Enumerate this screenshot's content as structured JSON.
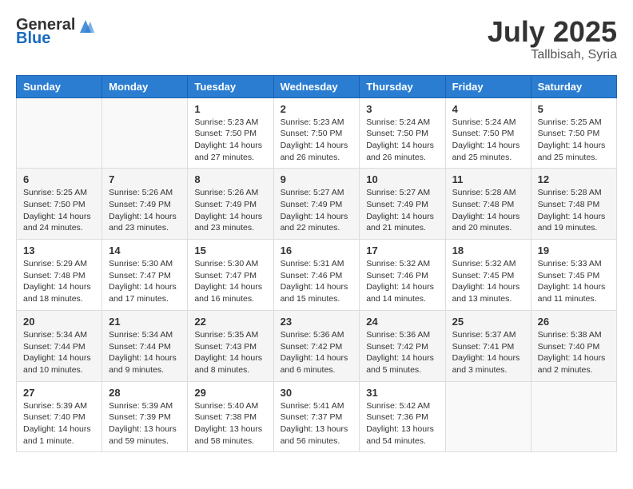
{
  "header": {
    "logo_general": "General",
    "logo_blue": "Blue",
    "month_year": "July 2025",
    "location": "Tallbisah, Syria"
  },
  "weekdays": [
    "Sunday",
    "Monday",
    "Tuesday",
    "Wednesday",
    "Thursday",
    "Friday",
    "Saturday"
  ],
  "weeks": [
    [
      {
        "day": "",
        "info": ""
      },
      {
        "day": "",
        "info": ""
      },
      {
        "day": "1",
        "info": "Sunrise: 5:23 AM\nSunset: 7:50 PM\nDaylight: 14 hours and 27 minutes."
      },
      {
        "day": "2",
        "info": "Sunrise: 5:23 AM\nSunset: 7:50 PM\nDaylight: 14 hours and 26 minutes."
      },
      {
        "day": "3",
        "info": "Sunrise: 5:24 AM\nSunset: 7:50 PM\nDaylight: 14 hours and 26 minutes."
      },
      {
        "day": "4",
        "info": "Sunrise: 5:24 AM\nSunset: 7:50 PM\nDaylight: 14 hours and 25 minutes."
      },
      {
        "day": "5",
        "info": "Sunrise: 5:25 AM\nSunset: 7:50 PM\nDaylight: 14 hours and 25 minutes."
      }
    ],
    [
      {
        "day": "6",
        "info": "Sunrise: 5:25 AM\nSunset: 7:50 PM\nDaylight: 14 hours and 24 minutes."
      },
      {
        "day": "7",
        "info": "Sunrise: 5:26 AM\nSunset: 7:49 PM\nDaylight: 14 hours and 23 minutes."
      },
      {
        "day": "8",
        "info": "Sunrise: 5:26 AM\nSunset: 7:49 PM\nDaylight: 14 hours and 23 minutes."
      },
      {
        "day": "9",
        "info": "Sunrise: 5:27 AM\nSunset: 7:49 PM\nDaylight: 14 hours and 22 minutes."
      },
      {
        "day": "10",
        "info": "Sunrise: 5:27 AM\nSunset: 7:49 PM\nDaylight: 14 hours and 21 minutes."
      },
      {
        "day": "11",
        "info": "Sunrise: 5:28 AM\nSunset: 7:48 PM\nDaylight: 14 hours and 20 minutes."
      },
      {
        "day": "12",
        "info": "Sunrise: 5:28 AM\nSunset: 7:48 PM\nDaylight: 14 hours and 19 minutes."
      }
    ],
    [
      {
        "day": "13",
        "info": "Sunrise: 5:29 AM\nSunset: 7:48 PM\nDaylight: 14 hours and 18 minutes."
      },
      {
        "day": "14",
        "info": "Sunrise: 5:30 AM\nSunset: 7:47 PM\nDaylight: 14 hours and 17 minutes."
      },
      {
        "day": "15",
        "info": "Sunrise: 5:30 AM\nSunset: 7:47 PM\nDaylight: 14 hours and 16 minutes."
      },
      {
        "day": "16",
        "info": "Sunrise: 5:31 AM\nSunset: 7:46 PM\nDaylight: 14 hours and 15 minutes."
      },
      {
        "day": "17",
        "info": "Sunrise: 5:32 AM\nSunset: 7:46 PM\nDaylight: 14 hours and 14 minutes."
      },
      {
        "day": "18",
        "info": "Sunrise: 5:32 AM\nSunset: 7:45 PM\nDaylight: 14 hours and 13 minutes."
      },
      {
        "day": "19",
        "info": "Sunrise: 5:33 AM\nSunset: 7:45 PM\nDaylight: 14 hours and 11 minutes."
      }
    ],
    [
      {
        "day": "20",
        "info": "Sunrise: 5:34 AM\nSunset: 7:44 PM\nDaylight: 14 hours and 10 minutes."
      },
      {
        "day": "21",
        "info": "Sunrise: 5:34 AM\nSunset: 7:44 PM\nDaylight: 14 hours and 9 minutes."
      },
      {
        "day": "22",
        "info": "Sunrise: 5:35 AM\nSunset: 7:43 PM\nDaylight: 14 hours and 8 minutes."
      },
      {
        "day": "23",
        "info": "Sunrise: 5:36 AM\nSunset: 7:42 PM\nDaylight: 14 hours and 6 minutes."
      },
      {
        "day": "24",
        "info": "Sunrise: 5:36 AM\nSunset: 7:42 PM\nDaylight: 14 hours and 5 minutes."
      },
      {
        "day": "25",
        "info": "Sunrise: 5:37 AM\nSunset: 7:41 PM\nDaylight: 14 hours and 3 minutes."
      },
      {
        "day": "26",
        "info": "Sunrise: 5:38 AM\nSunset: 7:40 PM\nDaylight: 14 hours and 2 minutes."
      }
    ],
    [
      {
        "day": "27",
        "info": "Sunrise: 5:39 AM\nSunset: 7:40 PM\nDaylight: 14 hours and 1 minute."
      },
      {
        "day": "28",
        "info": "Sunrise: 5:39 AM\nSunset: 7:39 PM\nDaylight: 13 hours and 59 minutes."
      },
      {
        "day": "29",
        "info": "Sunrise: 5:40 AM\nSunset: 7:38 PM\nDaylight: 13 hours and 58 minutes."
      },
      {
        "day": "30",
        "info": "Sunrise: 5:41 AM\nSunset: 7:37 PM\nDaylight: 13 hours and 56 minutes."
      },
      {
        "day": "31",
        "info": "Sunrise: 5:42 AM\nSunset: 7:36 PM\nDaylight: 13 hours and 54 minutes."
      },
      {
        "day": "",
        "info": ""
      },
      {
        "day": "",
        "info": ""
      }
    ]
  ]
}
